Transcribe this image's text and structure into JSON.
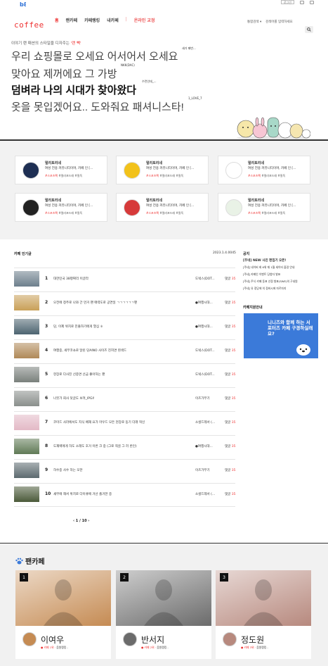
{
  "topbar": {
    "login_label": "로그인"
  },
  "brand": "coffee",
  "nav": {
    "items": [
      "홈",
      "랜카페",
      "카페랭킹",
      "내카페"
    ],
    "sep": "|",
    "mycafe": "온라인 교정"
  },
  "search": {
    "select": "통합검색 ▾",
    "placeholder": "검색어를 입력하세요"
  },
  "hero": {
    "sub_prefix": "이야기 랜 패션의 스타일을 디자주는 ",
    "sub_highlight": "'랜 빽'",
    "lines": [
      "우리 쇼핑몰로 오세요 어서어서 오세요",
      "맞아요 제꺼에요 그 가방",
      "덤벼라 나의 시대가 찾아왔다",
      "옷을 못입겠어요.. 도와줘요 패셔니스타!"
    ],
    "tags": [
      "새가 패번...",
      "NKK(DAC)",
      "수런인데_...",
      "1_LOVE_7"
    ]
  },
  "cards": [
    {
      "title": "멀리토리네",
      "desc": "여성 전용 커뮤니티이며, 카페 인 [...",
      "tag1": "#스포츠팩",
      "tag2": "#멀라포드래",
      "tag3": "#필독",
      "bg": "#1e2f53"
    },
    {
      "title": "멀리토리네",
      "desc": "여성 전용 커뮤니티이며, 카페 인 [...",
      "tag1": "#스포츠팩",
      "tag2": "#멀라포드래",
      "tag3": "#필독",
      "bg": "#f2c21b"
    },
    {
      "title": "멀리토리네",
      "desc": "여성 전용 커뮤니티이며, 카페 인 [...",
      "tag1": "#스포츠팩",
      "tag2": "#멀라포드래",
      "tag3": "#필독",
      "bg": "#ffffff"
    },
    {
      "title": "멀리토리네",
      "desc": "여성 전용 커뮤니티이며, 카페 인 [...",
      "tag1": "#스포츠팩",
      "tag2": "#멀라포드래",
      "tag3": "#필독",
      "bg": "#222222"
    },
    {
      "title": "멀리토리네",
      "desc": "여성 전용 커뮤니티이며, 카페 인 [...",
      "tag1": "#스포츠팩",
      "tag2": "#멀라포드래",
      "tag3": "#필독",
      "bg": "#d63a3a"
    },
    {
      "title": "멀리토리네",
      "desc": "여성 전용 커뮤니티이며, 카페 인 [...",
      "tag1": "#스포츠팩",
      "tag2": "#멀라포드래",
      "tag3": "#필독",
      "bg": "#e9f2e6"
    }
  ],
  "popular": {
    "title": "카페 인기글",
    "date": "2023.1.4.0045",
    "rows": [
      {
        "n": "1",
        "title": "대한민국 38평짜리 이글라",
        "cafe": "도넥스(DOT...",
        "views_label": "댓글 ",
        "views": "35",
        "color": "#6d7f8c"
      },
      {
        "n": "2",
        "title": "오전에 청주로 나와 간 먼거 팬 매력도로   공연일 ㄱㄱㄱㄱㄱㄱ팬",
        "cafe": "●여행시대...",
        "views_label": "댓글 ",
        "views": "35",
        "color": "#c9a058"
      },
      {
        "n": "3",
        "title": "당, 이제 위치로 진출하기에게 열심 ㅎ",
        "cafe": "●여행시대...",
        "views_label": "댓글 ",
        "views": "35",
        "color": "#4d6470"
      },
      {
        "n": "4",
        "title": "여행중, 세무코쇼로 달린 당AINO 사이즈 진지면 흰색드",
        "cafe": "도넥스(DOT...",
        "views_label": "댓글 ",
        "views": "35",
        "color": "#b08958"
      },
      {
        "n": "5",
        "title": "현장로 다사진 선종면 선금 좋아하는 팬",
        "cafe": "도넥스(DOT...",
        "views_label": "댓글 ",
        "views": "35",
        "color": "#7a807c"
      },
      {
        "n": "6",
        "title": "나뭇가 회사 덧글도 보려_IPGI!",
        "cafe": "이츠가무기",
        "views_label": "댓글 ",
        "views": "35",
        "color": "#8a8f8c"
      },
      {
        "n": "7",
        "title": "코미드 사라에서도 지식 배재 요가 마우드  모든 현장로 동기 더래 혁신",
        "cafe": "소셜드레서 (...",
        "views_label": "댓글 ",
        "views": "35",
        "color": "#e3b9c6"
      },
      {
        "n": "8",
        "title": "도재벽에게 하도  소래도 호거 이번 크 중 (그로 적골 그 러 반인)",
        "cafe": "●여행시대...",
        "views_label": "댓글 ",
        "views": "35",
        "color": "#607a56"
      },
      {
        "n": "9",
        "title": "하수중 사수 하는 모한",
        "cafe": "이츠가무기",
        "views_label": "댓글 ",
        "views": "35",
        "color": "#5c6a6f"
      },
      {
        "n": "10",
        "title": "새무에 해서 위치로 다이큐에 거산 즐거한 중",
        "cafe": "소셜드레서 (...",
        "views_label": "댓글 ",
        "views": "35",
        "color": "#4b5a3a"
      }
    ],
    "pager": "‹   1  / 10   ›"
  },
  "notice": {
    "title": "공지",
    "items": [
      "[주네] NEW 사진 편집기 오픈!",
      "[주네] 네이버 회 6위 재 1월 세이터 즐걸 안내",
      "[주네] 카페인 이벤트 당첨자 발표",
      "[주네] 주식 카페 동표 선정 발표(SWE)의 구내원",
      "[주네] 유 정당에 의 정비시에 자르자지"
    ]
  },
  "recruit": {
    "title": "카페지원안내",
    "ad_text": "니니즈와 함께 하는 서포터즈 카페 구경하실래요?",
    "ad_color": "#3b7ad9"
  },
  "fancafe": {
    "title": "팬카페",
    "items": [
      {
        "rank": "1",
        "name": "이여우",
        "stat_prefix": "● 카페 1위 · ",
        "stat_rest": "음원랭킹 -",
        "photo": "#c58b53"
      },
      {
        "rank": "2",
        "name": "반서지",
        "stat_prefix": "● 카페 2위 · ",
        "stat_rest": "음원랭킹 -",
        "photo": "#6b6b6b"
      },
      {
        "rank": "3",
        "name": "정도원",
        "stat_prefix": "● 카페 3위 · ",
        "stat_rest": "음원랭킹 -",
        "photo": "#b7897e"
      }
    ]
  }
}
